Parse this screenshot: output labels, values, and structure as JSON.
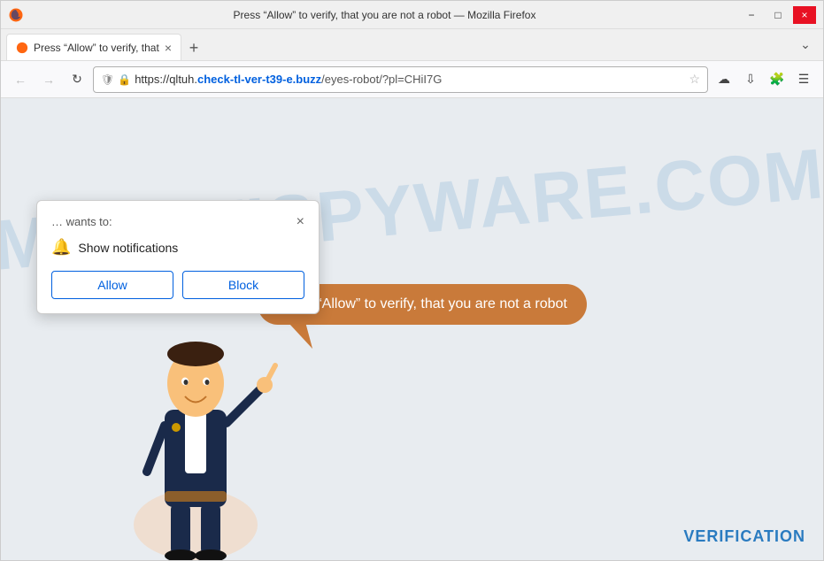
{
  "titlebar": {
    "title": "Press “Allow” to verify, that you are not a robot — Mozilla Firefox",
    "minimize_label": "−",
    "restore_label": "□",
    "close_label": "×"
  },
  "tab": {
    "label": "Press “Allow” to verify, that",
    "close_label": "×",
    "new_tab_label": "+"
  },
  "addressbar": {
    "url_plain": "https://qltuh.",
    "url_highlight": "check-tl-ver-t39-e.buzz",
    "url_rest": "/eyes-robot/?pl=CHiI7G"
  },
  "popup": {
    "wants_to": "… wants to:",
    "close_label": "×",
    "notification_label": "Show notifications",
    "allow_label": "Allow",
    "block_label": "Block"
  },
  "page": {
    "speech_bubble": "Press “Allow” to verify, that you are not a robot",
    "watermark_line1": "MYANTISPYWARE.COM",
    "verification_label": "VERIFICATION"
  }
}
